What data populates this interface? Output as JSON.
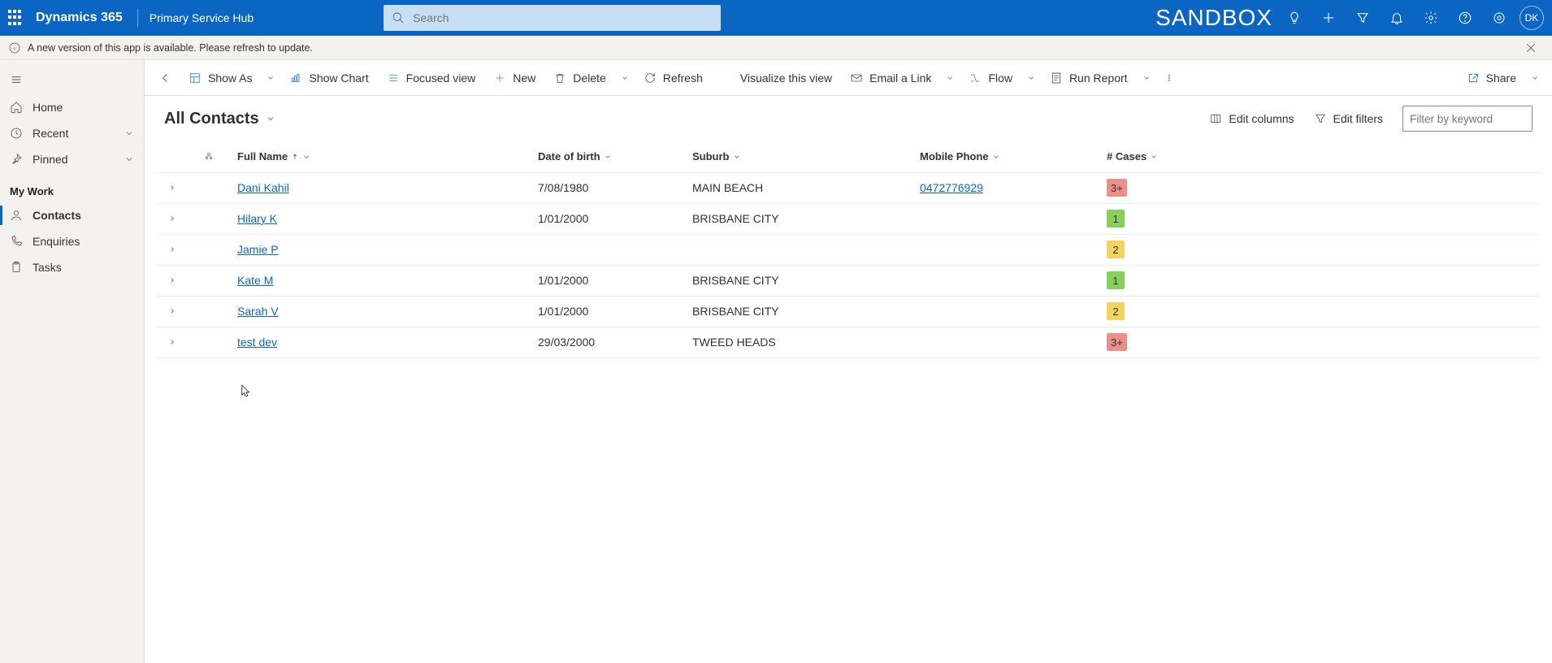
{
  "topbar": {
    "brand": "Dynamics 365",
    "app_name": "Primary Service Hub",
    "search_placeholder": "Search",
    "env_label": "SANDBOX",
    "avatar_initials": "DK"
  },
  "notification": {
    "text": "A new version of this app is available. Please refresh to update."
  },
  "sidebar": {
    "home": "Home",
    "recent": "Recent",
    "pinned": "Pinned",
    "group_my_work": "My Work",
    "contacts": "Contacts",
    "enquiries": "Enquiries",
    "tasks": "Tasks"
  },
  "commands": {
    "show_as": "Show As",
    "show_chart": "Show Chart",
    "focused_view": "Focused view",
    "new": "New",
    "delete": "Delete",
    "refresh": "Refresh",
    "visualize": "Visualize this view",
    "email_link": "Email a Link",
    "flow": "Flow",
    "run_report": "Run Report",
    "share": "Share"
  },
  "view": {
    "title": "All Contacts",
    "edit_columns": "Edit columns",
    "edit_filters": "Edit filters",
    "filter_placeholder": "Filter by keyword"
  },
  "columns": {
    "full_name": "Full Name",
    "dob": "Date of birth",
    "suburb": "Suburb",
    "mobile": "Mobile Phone",
    "cases": "# Cases"
  },
  "rows": [
    {
      "name": "Dani Kahil",
      "dob": "7/08/1980",
      "suburb": "MAIN BEACH",
      "phone": "0472776929",
      "cases": "3+",
      "badge": "red"
    },
    {
      "name": "Hilary K",
      "dob": "1/01/2000",
      "suburb": "BRISBANE CITY",
      "phone": "",
      "cases": "1",
      "badge": "green"
    },
    {
      "name": "Jamie P",
      "dob": "",
      "suburb": "",
      "phone": "",
      "cases": "2",
      "badge": "yellow"
    },
    {
      "name": "Kate M",
      "dob": "1/01/2000",
      "suburb": "BRISBANE CITY",
      "phone": "",
      "cases": "1",
      "badge": "green"
    },
    {
      "name": "Sarah V",
      "dob": "1/01/2000",
      "suburb": "BRISBANE CITY",
      "phone": "",
      "cases": "2",
      "badge": "yellow"
    },
    {
      "name": "test dev",
      "dob": "29/03/2000",
      "suburb": "TWEED HEADS",
      "phone": "",
      "cases": "3+",
      "badge": "red"
    }
  ]
}
